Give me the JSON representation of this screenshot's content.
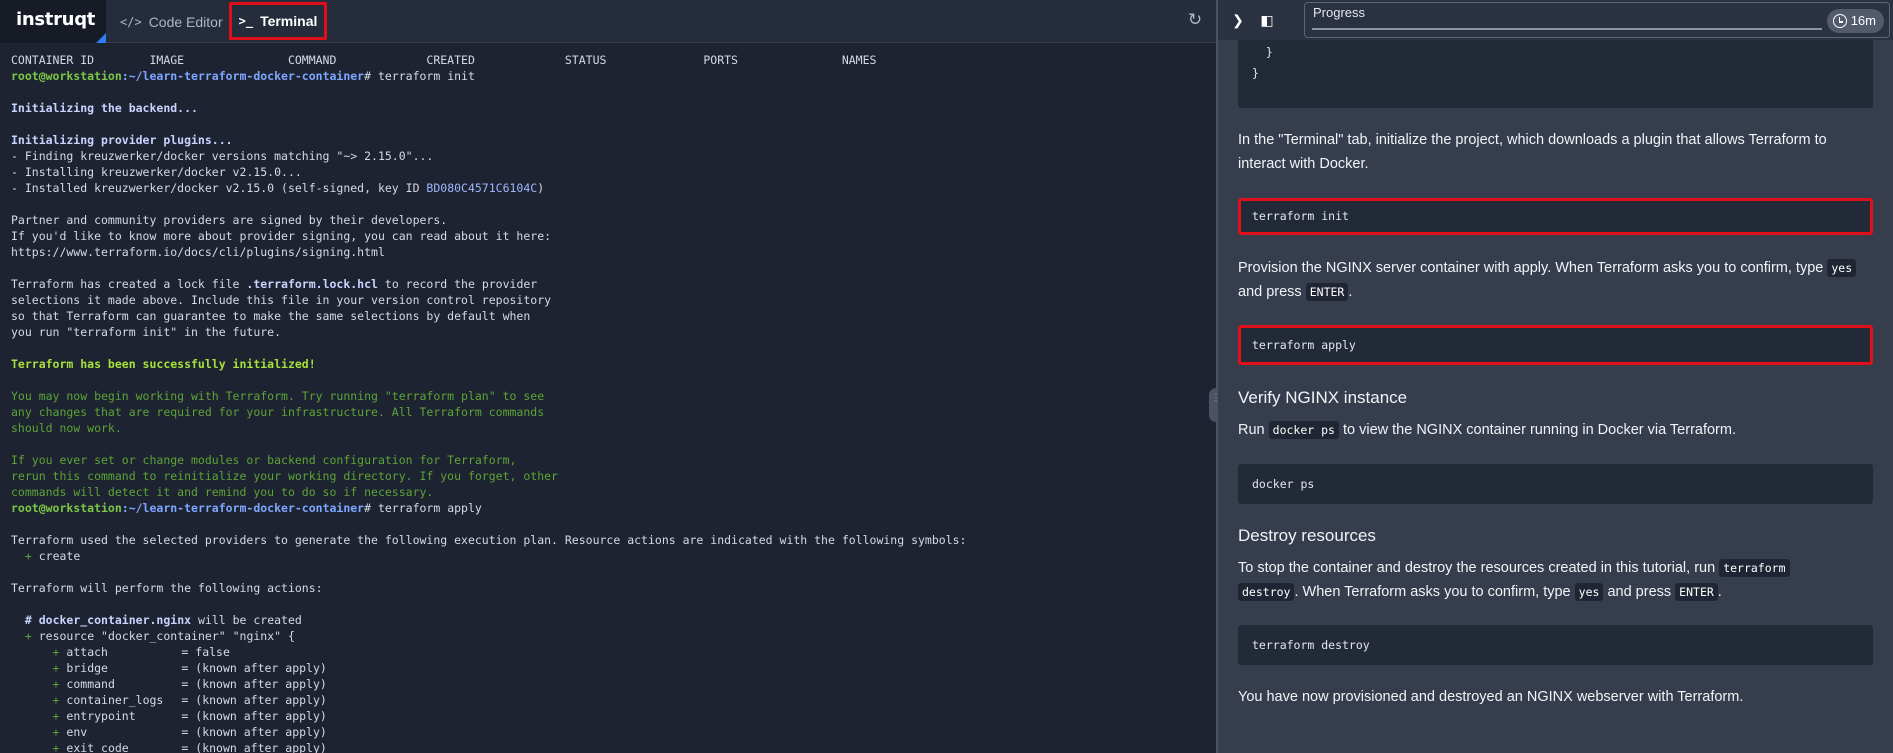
{
  "header": {
    "logo": "instruqt",
    "tabs": [
      {
        "label": "Code Editor",
        "icon": "code-icon"
      },
      {
        "label": "Terminal",
        "icon": "terminal-icon",
        "active": true
      }
    ],
    "refresh_icon": "refresh-icon"
  },
  "terminal": {
    "docker_ps_header": "CONTAINER ID        IMAGE               COMMAND             CREATED             STATUS              PORTS               NAMES",
    "prompt_user": "root@workstation",
    "prompt_path": ":~/learn-terraform-docker-container",
    "cmd_init": "# terraform init",
    "init_backend": "Initializing the backend...",
    "init_plugins": "Initializing provider plugins...",
    "finding": "- Finding kreuzwerker/docker versions matching \"~> 2.15.0\"...",
    "installing": "- Installing kreuzwerker/docker v2.15.0...",
    "installed_prefix": "- Installed kreuzwerker/docker v2.15.0 (self-signed, key ID ",
    "installed_key": "BD080C4571C6104C",
    "installed_suffix": ")",
    "partner_1": "Partner and community providers are signed by their developers.",
    "partner_2": "If you'd like to know more about provider signing, you can read about it here:",
    "partner_3": "https://www.terraform.io/docs/cli/plugins/signing.html",
    "lock_1a": "Terraform has created a lock file ",
    "lock_1b": ".terraform.lock.hcl",
    "lock_1c": " to record the provider",
    "lock_2": "selections it made above. Include this file in your version control repository",
    "lock_3": "so that Terraform can guarantee to make the same selections by default when",
    "lock_4": "you run \"terraform init\" in the future.",
    "success": "Terraform has been successfully initialized!",
    "g1": "You may now begin working with Terraform. Try running \"terraform plan\" to see",
    "g2": "any changes that are required for your infrastructure. All Terraform commands",
    "g3": "should now work.",
    "g4": "If you ever set or change modules or backend configuration for Terraform,",
    "g5": "rerun this command to reinitialize your working directory. If you forget, other",
    "g6": "commands will detect it and remind you to do so if necessary.",
    "cmd_apply": "# terraform apply",
    "plan_1": "Terraform used the selected providers to generate the following execution plan. Resource actions are indicated with the following symbols:",
    "plan_2_sym": "+",
    "plan_2_text": " create",
    "perform": "Terraform will perform the following actions:",
    "res_hash": "# ",
    "res_name": "docker_container.nginx",
    "res_will": " will be created",
    "res_decl": "resource \"docker_container\" \"nginx\" {",
    "attrs": [
      {
        "k": "attach",
        "v": "= false"
      },
      {
        "k": "bridge",
        "v": "= (known after apply)"
      },
      {
        "k": "command",
        "v": "= (known after apply)"
      },
      {
        "k": "container_logs",
        "v": "= (known after apply)"
      },
      {
        "k": "entrypoint",
        "v": "= (known after apply)"
      },
      {
        "k": "env",
        "v": "= (known after apply)"
      },
      {
        "k": "exit_code",
        "v": "= (known after apply)"
      }
    ]
  },
  "sidebar": {
    "toolbar": {
      "expand_icon": "chevron-right-icon",
      "panel_icon": "panel-toggle-icon"
    },
    "progress": {
      "label": "Progress",
      "timer": "16m",
      "fraction": 0.0
    },
    "code_tail_1": "  }",
    "code_tail_2": "}",
    "p_init": "In the \"Terminal\" tab, initialize the project, which downloads a plugin that allows Terraform to interact with Docker.",
    "code_init": "terraform init",
    "p_apply_a": "Provision the NGINX server container with apply. When Terraform asks you to confirm, type ",
    "p_apply_yes": "yes",
    "p_apply_b": " and press ",
    "p_apply_enter": "ENTER",
    "p_apply_c": ".",
    "code_apply": "terraform apply",
    "h_verify": "Verify NGINX instance",
    "p_verify_a": "Run ",
    "p_verify_code": "docker ps",
    "p_verify_b": " to view the NGINX container running in Docker via Terraform.",
    "code_ps": "docker ps",
    "h_destroy": "Destroy resources",
    "p_destroy_a": "To stop the container and destroy the resources created in this tutorial, run ",
    "p_destroy_code1": "terraform",
    "p_destroy_code2": "destroy",
    "p_destroy_b": ". When Terraform asks you to confirm, type ",
    "p_destroy_yes": "yes",
    "p_destroy_c": " and press ",
    "p_destroy_enter": "ENTER",
    "p_destroy_d": ".",
    "code_destroy": "terraform destroy",
    "p_done": "You have now provisioned and destroyed an NGINX webserver with Terraform."
  }
}
